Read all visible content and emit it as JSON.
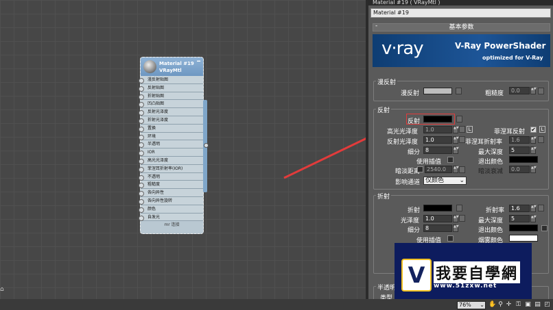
{
  "editor": {
    "panel_title": "Material #19 ( VRayMtl )",
    "material_name": "Material #19",
    "basic_rollout": "基本参数",
    "banner": {
      "logo": "v·ray",
      "title": "V-Ray PowerShader",
      "subtitle": "optimized for V-Ray"
    },
    "diffuse": {
      "group": "漫反射",
      "label": "漫反射",
      "roughness_label": "粗糙度",
      "roughness_value": "0.0",
      "swatch_color": "#bdbdbd"
    },
    "reflection": {
      "group": "反射",
      "label": "反射",
      "swatch_color": "#000000",
      "hilight_gloss_label": "高光光泽度",
      "hilight_gloss_value": "1.0",
      "lock_label": "L",
      "fresnel_label": "菲涅耳反射",
      "fresnel_checked": "✔",
      "fresnel_lock": "L",
      "refl_gloss_label": "反射光泽度",
      "refl_gloss_value": "1.0",
      "fresnel_ior_label": "菲涅耳折射率",
      "fresnel_ior_value": "1.6",
      "subdivs_label": "细分",
      "subdivs_value": "8",
      "max_depth_label": "最大深度",
      "max_depth_value": "5",
      "use_interp_label": "使用插值",
      "exit_color_label": "退出颜色",
      "dim_dist_label": "暗淡距离",
      "dim_dist_value": "2540.0",
      "dim_falloff_label": "暗淡衰减",
      "dim_falloff_value": "0.0",
      "affect_channels_label": "影响通道",
      "affect_channels_value": "仅颜色"
    },
    "refraction": {
      "group": "折射",
      "label": "折射",
      "ior_label": "折射率",
      "ior_value": "1.6",
      "gloss_label": "光泽度",
      "gloss_value": "1.0",
      "max_depth_label": "最大深度",
      "max_depth_value": "5",
      "subdivs_label": "细分",
      "subdivs_value": "8",
      "exit_color_label": "退出颜色",
      "use_interp_label": "使用插值",
      "fog_color_label": "烟雾颜色"
    },
    "translucency": {
      "group": "半透明",
      "type_label": "类型"
    }
  },
  "node": {
    "title": "Material #19",
    "subtitle": "VRayMtl",
    "collapse": "━",
    "slots": [
      "漫反射贴图",
      "反射贴图",
      "折射贴图",
      "凹凸贴图",
      "反射光泽度",
      "折射光泽度",
      "置换",
      "环境",
      "半透明",
      "IOR",
      "高光光泽度",
      "菲涅耳折射率(IOR)",
      "不透明",
      "粗糙度",
      "各向异性",
      "各向异性旋转",
      "颜色",
      "自发光"
    ],
    "footer": "mr 连接"
  },
  "watermark": {
    "logo": "V",
    "text": "我要自學網",
    "url": "www.51zxw.net"
  },
  "statusbar": {
    "zoom": "76%"
  }
}
